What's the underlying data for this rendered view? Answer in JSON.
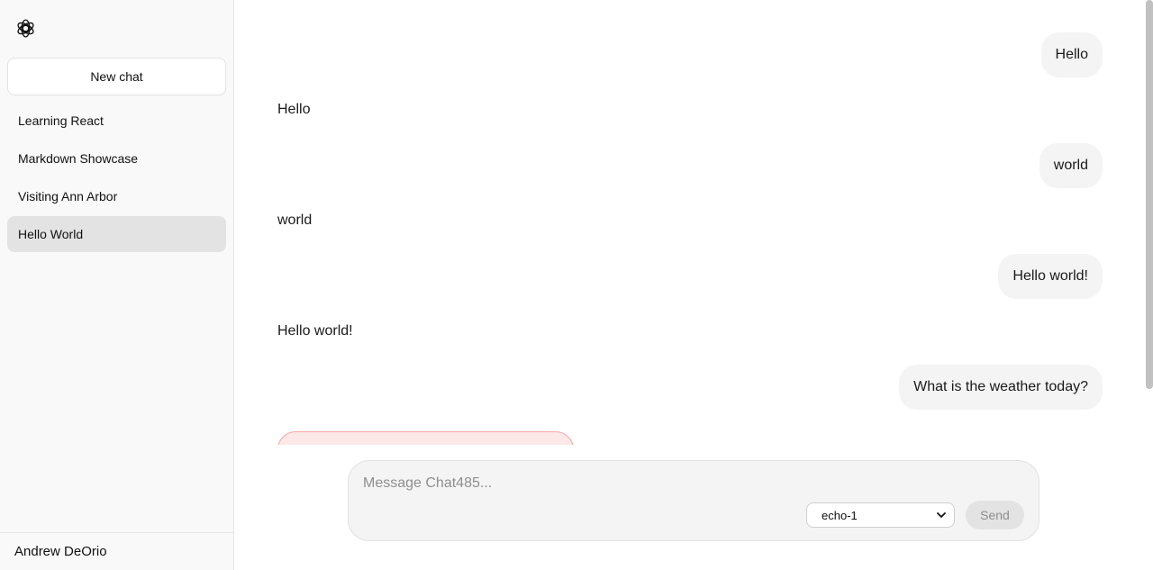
{
  "sidebar": {
    "logo_icon": "openai-logo-icon",
    "new_chat_label": "New chat",
    "chats": [
      {
        "label": "Learning React",
        "active": false
      },
      {
        "label": "Markdown Showcase",
        "active": false
      },
      {
        "label": "Visiting Ann Arbor",
        "active": false
      },
      {
        "label": "Hello World",
        "active": true
      }
    ],
    "user_name": "Andrew DeOrio"
  },
  "conversation": {
    "messages": [
      {
        "role": "user",
        "text": "Hello"
      },
      {
        "role": "assistant",
        "text": "Hello"
      },
      {
        "role": "user",
        "text": "world"
      },
      {
        "role": "assistant",
        "text": "world"
      },
      {
        "role": "user",
        "text": "Hello world!"
      },
      {
        "role": "assistant",
        "text": "Hello world!"
      },
      {
        "role": "user",
        "text": "What is the weather today?"
      }
    ]
  },
  "composer": {
    "placeholder": "Message Chat485...",
    "value": "",
    "model_selected": "echo-1",
    "send_label": "Send"
  },
  "colors": {
    "sidebar_bg": "#f9f9f9",
    "active_item_bg": "#e3e3e3",
    "bubble_bg": "#f4f4f4",
    "error_bg": "#fde8e8",
    "error_border": "#f4a7a7"
  }
}
